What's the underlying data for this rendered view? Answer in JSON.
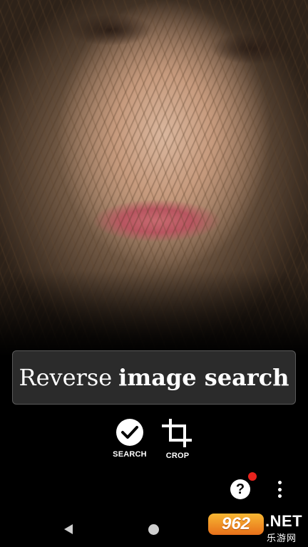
{
  "banner": {
    "regular": "Reverse",
    "bold": "image search"
  },
  "tools": {
    "search_label": "SEARCH",
    "crop_label": "CROP"
  },
  "help": {
    "glyph": "?"
  },
  "watermark": {
    "logo": "962",
    "net": ".NET",
    "sub": "乐游网"
  },
  "colors": {
    "background": "#000000",
    "banner_bg": "#2b2b2b",
    "notification_dot": "#e8231d"
  },
  "icons": [
    "check-icon",
    "crop-icon",
    "help-icon",
    "more-vert-icon",
    "back-icon",
    "home-icon"
  ]
}
